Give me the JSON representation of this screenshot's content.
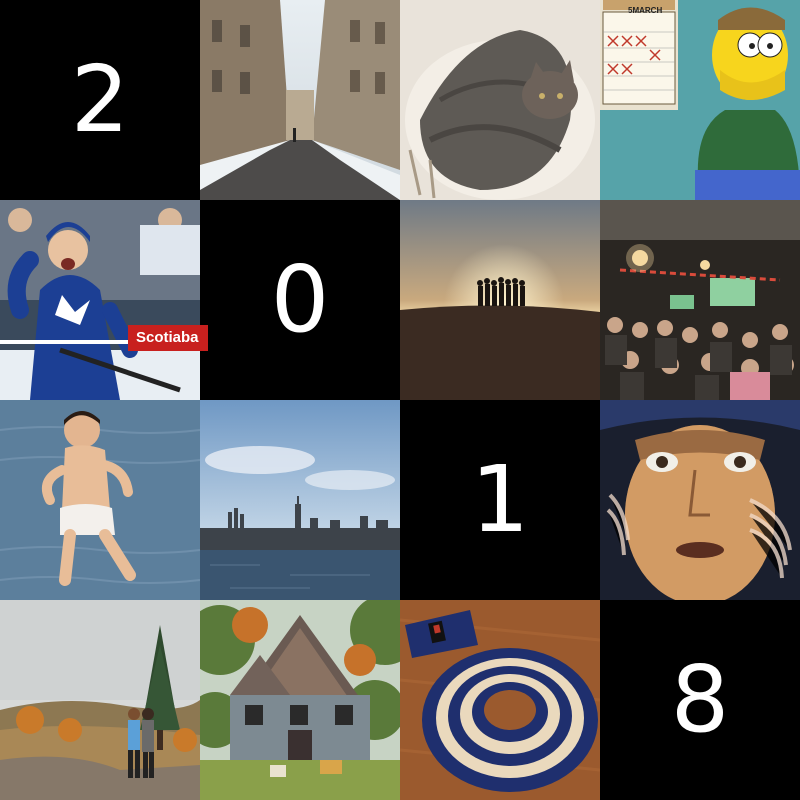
{
  "digits": [
    "2",
    "0",
    "1",
    "8"
  ],
  "texts": {
    "calendar_month": "5MARCH",
    "sponsor_board": "Scotiaba"
  },
  "tiles": [
    {
      "name": "digit-2",
      "kind": "digit"
    },
    {
      "name": "snowy-city-street-photo",
      "kind": "photo"
    },
    {
      "name": "cat-in-sweater-photo",
      "kind": "photo"
    },
    {
      "name": "cartoon-calendar-photo",
      "kind": "photo"
    },
    {
      "name": "hockey-player-photo",
      "kind": "photo"
    },
    {
      "name": "digit-0",
      "kind": "digit"
    },
    {
      "name": "desert-silhouette-photo",
      "kind": "photo"
    },
    {
      "name": "pub-crowd-photo",
      "kind": "photo"
    },
    {
      "name": "child-in-water-photo",
      "kind": "photo"
    },
    {
      "name": "city-skyline-photo",
      "kind": "photo"
    },
    {
      "name": "digit-1",
      "kind": "digit"
    },
    {
      "name": "astronaut-face-photo",
      "kind": "photo"
    },
    {
      "name": "autumn-couple-photo",
      "kind": "photo"
    },
    {
      "name": "old-house-photo",
      "kind": "photo"
    },
    {
      "name": "rolled-belt-photo",
      "kind": "photo"
    },
    {
      "name": "digit-8",
      "kind": "digit"
    }
  ]
}
